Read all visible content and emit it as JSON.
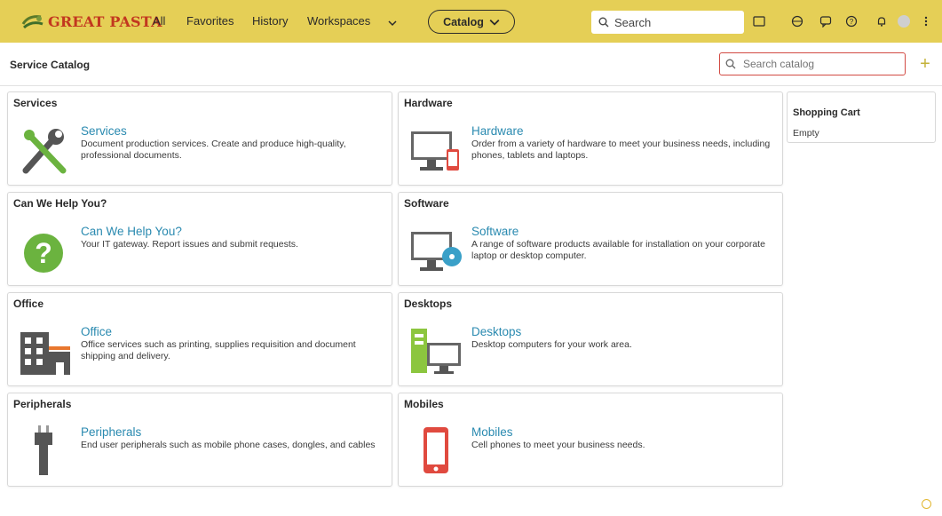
{
  "topbar": {
    "logo_text": "GREAT PASTA",
    "nav": [
      "All",
      "Favorites",
      "History",
      "Workspaces"
    ],
    "catalog_label": "Catalog",
    "search_placeholder": "Search",
    "colors": {
      "bar": "#e5cf56",
      "logo": "#c2371f"
    }
  },
  "page": {
    "title": "Service Catalog",
    "search_placeholder": "Search catalog",
    "add_icon": "plus-icon"
  },
  "cards": [
    {
      "head": "Services",
      "title": "Services",
      "desc": "Document production services. Create and produce high-quality, professional documents.",
      "icon": "tools-icon"
    },
    {
      "head": "Hardware",
      "title": "Hardware",
      "desc": "Order from a variety of hardware to meet your business needs, including phones, tablets and laptops.",
      "icon": "monitor-phone-icon"
    },
    {
      "head": "Can We Help You?",
      "title": "Can We Help You?",
      "desc": "Your IT gateway. Report issues and submit requests.",
      "icon": "question-icon"
    },
    {
      "head": "Software",
      "title": "Software",
      "desc": "A range of software products available for installation on your corporate laptop or desktop computer.",
      "icon": "monitor-disc-icon"
    },
    {
      "head": "Office",
      "title": "Office",
      "desc": "Office services such as printing, supplies requisition and document shipping and delivery.",
      "icon": "building-icon"
    },
    {
      "head": "Desktops",
      "title": "Desktops",
      "desc": "Desktop computers for your work area.",
      "icon": "desktop-icon"
    },
    {
      "head": "Peripherals",
      "title": "Peripherals",
      "desc": "End user peripherals such as mobile phone cases, dongles, and cables",
      "icon": "plug-icon"
    },
    {
      "head": "Mobiles",
      "title": "Mobiles",
      "desc": "Cell phones to meet your business needs.",
      "icon": "mobile-icon"
    }
  ],
  "cart": {
    "title": "Shopping Cart",
    "empty_text": "Empty"
  }
}
